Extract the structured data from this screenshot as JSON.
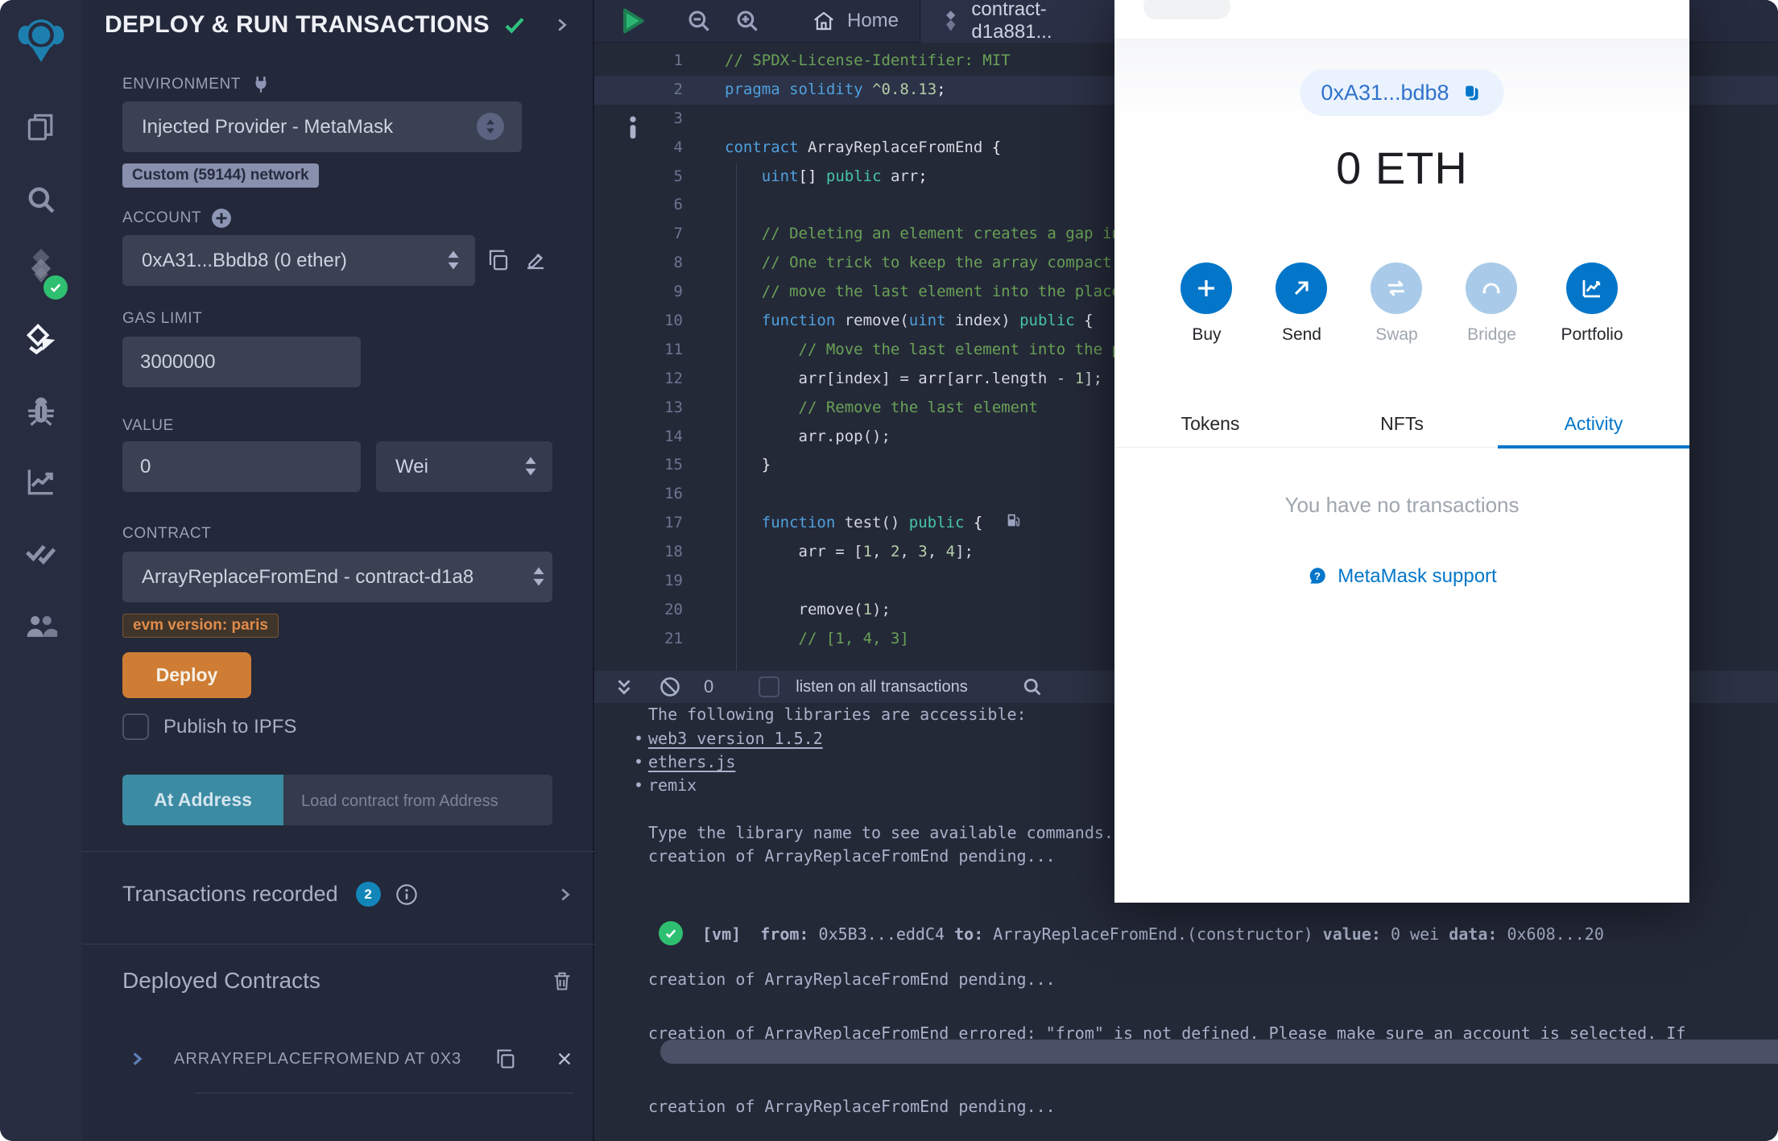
{
  "sidebar": {
    "icons": [
      "remix-logo",
      "file-explorer-icon",
      "search-icon",
      "solidity-compiler-icon",
      "deploy-run-icon",
      "debugger-icon",
      "analytics-icon",
      "unit-testing-icon",
      "plugin-manager-icon"
    ],
    "active_icon": "deploy-run-icon",
    "compiler_status": "success"
  },
  "deploy_panel": {
    "title": "DEPLOY & RUN TRANSACTIONS",
    "environment": {
      "label": "ENVIRONMENT",
      "value": "Injected Provider - MetaMask",
      "network_badge": "Custom (59144) network"
    },
    "account": {
      "label": "ACCOUNT",
      "value": "0xA31...Bbdb8 (0 ether)"
    },
    "gas_limit": {
      "label": "GAS LIMIT",
      "value": "3000000"
    },
    "value_field": {
      "label": "VALUE",
      "value": "0",
      "unit": "Wei"
    },
    "contract": {
      "label": "CONTRACT",
      "value": "ArrayReplaceFromEnd - contract-d1a8",
      "evm_badge": "evm version: paris"
    },
    "deploy_button": "Deploy",
    "publish_label": "Publish to IPFS",
    "at_address_button": "At Address",
    "at_address_placeholder": "Load contract from Address",
    "transactions_recorded": {
      "label": "Transactions recorded",
      "count": "2"
    },
    "deployed_contracts": {
      "title": "Deployed Contracts",
      "item_label": "ARRAYREPLACEFROMEND AT 0X3"
    }
  },
  "editor": {
    "tabs": [
      {
        "label": "Home",
        "active": false
      },
      {
        "label": "contract-d1a881...",
        "active": true
      }
    ],
    "lines": [
      {
        "n": 1,
        "seg": [
          [
            "c",
            "// SPDX-License-Identifier: MIT"
          ]
        ]
      },
      {
        "n": 2,
        "hl": true,
        "seg": [
          [
            "k",
            "pragma"
          ],
          [
            "p",
            " "
          ],
          [
            "k",
            "solidity"
          ],
          [
            "p",
            " "
          ],
          [
            "n",
            "^0.8.13"
          ],
          [
            "w",
            ";"
          ]
        ]
      },
      {
        "n": 3,
        "seg": []
      },
      {
        "n": 4,
        "seg": [
          [
            "k",
            "contract"
          ],
          [
            "p",
            " ArrayReplaceFromEnd "
          ],
          [
            "w",
            "{"
          ]
        ]
      },
      {
        "n": 5,
        "seg": [
          [
            "p",
            "    "
          ],
          [
            "k",
            "uint"
          ],
          [
            "w",
            "[]"
          ],
          [
            "p",
            " "
          ],
          [
            "t",
            "public"
          ],
          [
            "p",
            " arr"
          ],
          [
            "w",
            ";"
          ]
        ]
      },
      {
        "n": 6,
        "seg": []
      },
      {
        "n": 7,
        "seg": [
          [
            "p",
            "    "
          ],
          [
            "c",
            "// Deleting an element creates a gap in the array."
          ]
        ]
      },
      {
        "n": 8,
        "seg": [
          [
            "p",
            "    "
          ],
          [
            "c",
            "// One trick to keep the array compact is to"
          ]
        ]
      },
      {
        "n": 9,
        "seg": [
          [
            "p",
            "    "
          ],
          [
            "c",
            "// move the last element into the place to delete."
          ]
        ]
      },
      {
        "n": 10,
        "seg": [
          [
            "p",
            "    "
          ],
          [
            "k",
            "function"
          ],
          [
            "p",
            " remove("
          ],
          [
            "k",
            "uint"
          ],
          [
            "p",
            " index) "
          ],
          [
            "t",
            "public"
          ],
          [
            "p",
            " "
          ],
          [
            "w",
            "{"
          ]
        ]
      },
      {
        "n": 11,
        "seg": [
          [
            "p",
            "        "
          ],
          [
            "c",
            "// Move the last element into the place to delete"
          ]
        ]
      },
      {
        "n": 12,
        "seg": [
          [
            "p",
            "        arr[index] = arr[arr.length - "
          ],
          [
            "n",
            "1"
          ],
          [
            "p",
            "];"
          ]
        ]
      },
      {
        "n": 13,
        "seg": [
          [
            "p",
            "        "
          ],
          [
            "c",
            "// Remove the last element"
          ]
        ]
      },
      {
        "n": 14,
        "seg": [
          [
            "p",
            "        arr.pop();"
          ]
        ]
      },
      {
        "n": 15,
        "seg": [
          [
            "p",
            "    "
          ],
          [
            "w",
            "}"
          ]
        ]
      },
      {
        "n": 16,
        "seg": []
      },
      {
        "n": 17,
        "gas": true,
        "seg": [
          [
            "p",
            "    "
          ],
          [
            "k",
            "function"
          ],
          [
            "p",
            " test() "
          ],
          [
            "t",
            "public"
          ],
          [
            "p",
            " "
          ],
          [
            "w",
            "{"
          ]
        ]
      },
      {
        "n": 18,
        "seg": [
          [
            "p",
            "        arr = ["
          ],
          [
            "n",
            "1"
          ],
          [
            "p",
            ", "
          ],
          [
            "n",
            "2"
          ],
          [
            "p",
            ", "
          ],
          [
            "n",
            "3"
          ],
          [
            "p",
            ", "
          ],
          [
            "n",
            "4"
          ],
          [
            "p",
            "];"
          ]
        ]
      },
      {
        "n": 19,
        "seg": []
      },
      {
        "n": 20,
        "seg": [
          [
            "p",
            "        remove("
          ],
          [
            "n",
            "1"
          ],
          [
            "p",
            ");"
          ]
        ]
      },
      {
        "n": 21,
        "seg": [
          [
            "p",
            "        "
          ],
          [
            "c",
            "// [1, 4, 3]"
          ]
        ]
      }
    ]
  },
  "terminal": {
    "count": "0",
    "listen_label": "listen on all transactions",
    "lines": [
      {
        "kind": "text",
        "text": "The following libraries are accessible:"
      },
      {
        "kind": "link",
        "bullet": true,
        "text": "web3 version 1.5.2"
      },
      {
        "kind": "link",
        "bullet": true,
        "text": "ethers.js"
      },
      {
        "kind": "text",
        "bullet": true,
        "text": "remix"
      },
      {
        "kind": "text",
        "text": "Type the library name to see available commands."
      },
      {
        "kind": "text",
        "text": "creation of ArrayReplaceFromEnd pending..."
      },
      {
        "kind": "vm",
        "segments": [
          [
            "b",
            "[vm]"
          ],
          [
            "r",
            "  "
          ],
          [
            "b",
            "from:"
          ],
          [
            "r",
            " 0x5B3...eddC4 "
          ],
          [
            "b",
            "to:"
          ],
          [
            "r",
            " ArrayReplaceFromEnd.(constructor) "
          ],
          [
            "b",
            "value:"
          ],
          [
            "r",
            " 0 wei "
          ],
          [
            "b",
            "data:"
          ],
          [
            "r",
            " 0x608...20"
          ]
        ]
      },
      {
        "kind": "text",
        "text": "creation of ArrayReplaceFromEnd pending..."
      },
      {
        "kind": "text",
        "text": "creation of ArrayReplaceFromEnd errored: \"from\" is not defined. Please make sure an account is selected. If"
      },
      {
        "kind": "bar"
      },
      {
        "kind": "text",
        "text": "creation of ArrayReplaceFromEnd pending..."
      }
    ]
  },
  "metamask": {
    "address": "0xA31...bdb8",
    "balance": "0 ETH",
    "actions": [
      {
        "label": "Buy",
        "icon": "plus-icon",
        "enabled": true
      },
      {
        "label": "Send",
        "icon": "arrow-up-right-icon",
        "enabled": true
      },
      {
        "label": "Swap",
        "icon": "swap-arrows-icon",
        "enabled": false
      },
      {
        "label": "Bridge",
        "icon": "bridge-icon",
        "enabled": false
      },
      {
        "label": "Portfolio",
        "icon": "portfolio-chart-icon",
        "enabled": true
      }
    ],
    "tabs": [
      {
        "label": "Tokens",
        "active": false
      },
      {
        "label": "NFTs",
        "active": false
      },
      {
        "label": "Activity",
        "active": true
      }
    ],
    "empty_text": "You have no transactions",
    "support_link": "MetaMask support",
    "colors": {
      "accent": "#0376c9",
      "disabled": "#a9cbe9",
      "text": "#24272a",
      "muted": "#9fa6ae"
    }
  },
  "theme": {
    "panel_bg": "#23283a",
    "editor_bg": "#242938",
    "bar_bg": "#2c3245",
    "orange": "#cf7d34",
    "teal": "#3b8ba3",
    "green": "#2fbf71",
    "badge_blue": "#1286b8"
  }
}
